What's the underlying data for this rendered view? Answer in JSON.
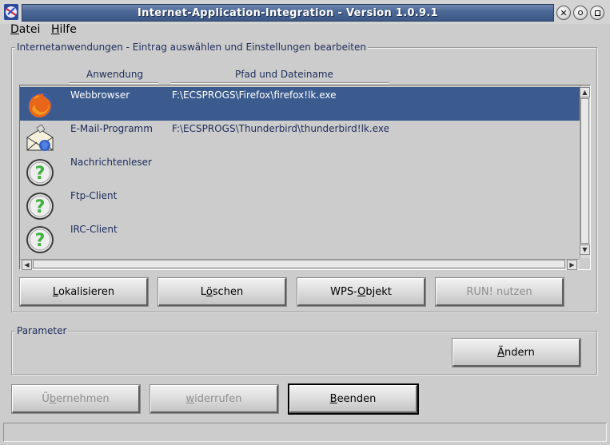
{
  "window": {
    "title": "Internet-Application-Integration - Version 1.0.9.1"
  },
  "menu": [
    {
      "label": "Datei",
      "mnemonic": "D",
      "rest": "atei"
    },
    {
      "label": "Hilfe",
      "mnemonic": "H",
      "rest": "ilfe"
    }
  ],
  "apps_group": {
    "label": "Internetanwendungen - Eintrag auswählen und Einstellungen bearbeiten",
    "columns": {
      "name": "Anwendung",
      "path": "Pfad und Dateiname"
    },
    "rows": [
      {
        "name": "Webbrowser",
        "path": "F:\\ECSPROGS\\Firefox\\firefox!lk.exe",
        "icon": "firefox-icon",
        "selected": true
      },
      {
        "name": "E-Mail-Programm",
        "path": "F:\\ECSPROGS\\Thunderbird\\thunderbird!lk.exe",
        "icon": "mail-envelope-icon",
        "selected": false
      },
      {
        "name": "Nachrichtenleser",
        "path": "",
        "icon": "question-mark-icon",
        "selected": false
      },
      {
        "name": "Ftp-Client",
        "path": "",
        "icon": "question-mark-icon",
        "selected": false
      },
      {
        "name": "IRC-Client",
        "path": "",
        "icon": "question-mark-icon",
        "selected": false
      }
    ],
    "buttons": {
      "localize": {
        "mnemonic": "L",
        "rest": "okalisieren"
      },
      "delete": {
        "pre": "L",
        "mnemonic": "ö",
        "rest": "schen"
      },
      "wps": {
        "pre": "WPS-",
        "mnemonic": "O",
        "rest": "bjekt"
      },
      "run": {
        "label": "RUN! nutzen"
      }
    }
  },
  "param_group": {
    "label": "Parameter",
    "change_button": {
      "mnemonic": "Ä",
      "rest": "ndern"
    }
  },
  "bottom_buttons": {
    "apply": {
      "pre": "Ü",
      "mnemonic": "b",
      "rest": "ernehmen"
    },
    "undo": {
      "mnemonic": "w",
      "rest": "iderrufen"
    },
    "quit": {
      "mnemonic": "B",
      "rest": "eenden"
    }
  },
  "colors": {
    "selection": "#3b5b8e",
    "title_bar": "#4b6796",
    "text_blue": "#1c2c5a"
  }
}
